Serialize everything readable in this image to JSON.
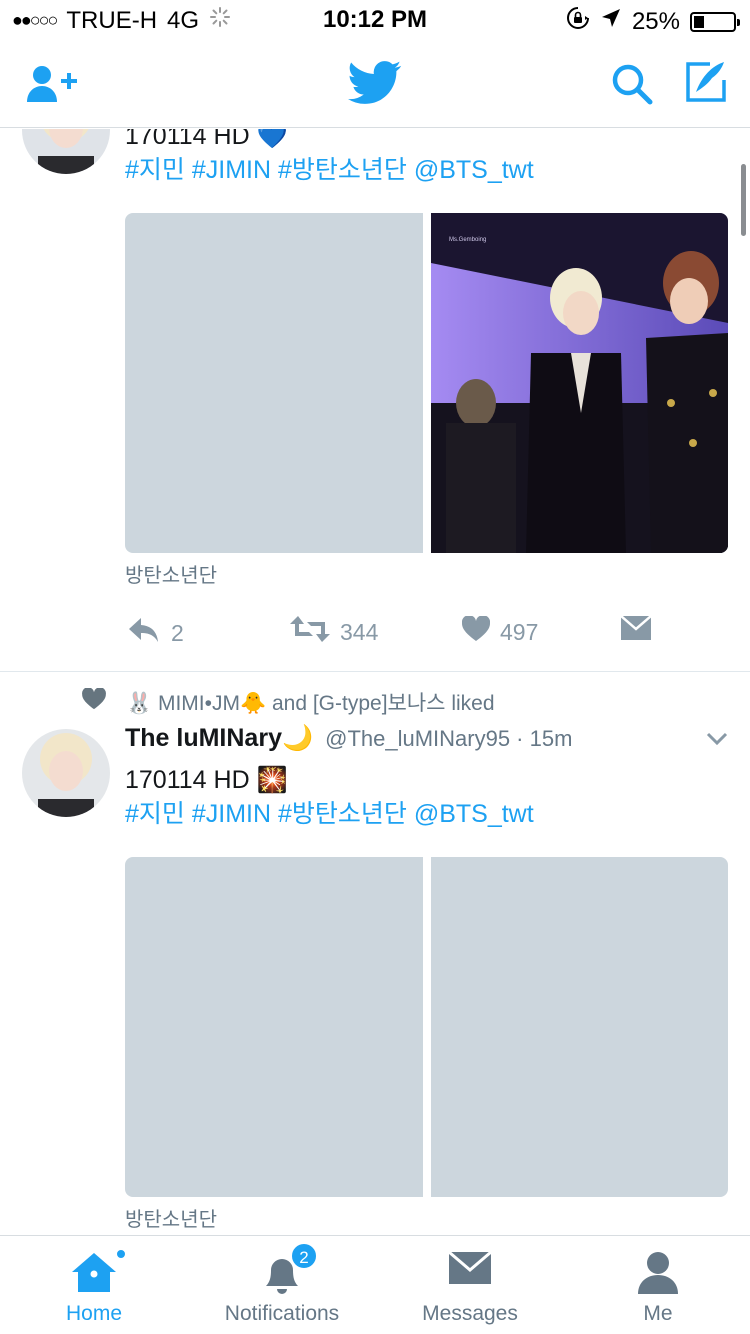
{
  "status_bar": {
    "signal_dots": "●●○○○",
    "carrier": "TRUE-H",
    "network": "4G",
    "time": "10:12 PM",
    "battery_percent": "25%",
    "battery_level": 0.25
  },
  "nav": {
    "add_user_icon": "add-user-icon",
    "logo_icon": "twitter-bird-icon",
    "search_icon": "search-icon",
    "compose_icon": "compose-icon",
    "accent": "#1da1f2"
  },
  "tweets": [
    {
      "text": "170114 HD 💙",
      "hashtags": "#지민 #JIMIN #방탄소년단 @BTS_twt",
      "media_caption": "방탄소년단",
      "replies": "2",
      "retweets": "344",
      "likes": "497",
      "photo_watermark": "Ms.Gemboing"
    },
    {
      "social_context": "🐰 MIMI•JM🐥 and [G-type]보나스 liked",
      "author_name": "The luMINary🌙",
      "author_handle": "@The_luMINary95 · 15m",
      "text": "170114 HD 🎇",
      "hashtags": "#지민 #JIMIN #방탄소년단 @BTS_twt",
      "media_caption": "방탄소년단"
    }
  ],
  "tabs": [
    {
      "label": "Home",
      "icon": "home-icon",
      "active": true
    },
    {
      "label": "Notifications",
      "icon": "bell-icon",
      "badge": "2"
    },
    {
      "label": "Messages",
      "icon": "envelope-icon"
    },
    {
      "label": "Me",
      "icon": "person-icon"
    }
  ]
}
